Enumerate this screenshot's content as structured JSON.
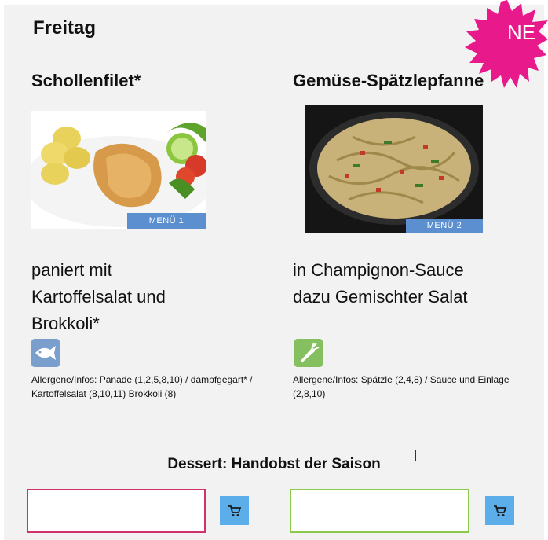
{
  "day": {
    "title": "Freitag"
  },
  "badge": {
    "label": "NE",
    "color": "#e8198b"
  },
  "dishes": [
    {
      "title": "Schollenfilet*",
      "menu_label": "MENÜ 1",
      "desc_lines": [
        "paniert mit",
        "Kartoffelsalat und",
        "Brokkoli*"
      ],
      "icon": "fish-icon",
      "allergen": "Allergene/Infos: Panade (1,2,5,8,10) / dampfgegart* / Kartoffelsalat (8,10,11) Brokkoli (8)",
      "input_border": "#d0336c"
    },
    {
      "title": "Gemüse-Spätzlepfanne",
      "menu_label": "MENÜ 2",
      "desc_lines": [
        "in Champignon-Sauce",
        "dazu Gemischter Salat"
      ],
      "icon": "carrot-icon",
      "allergen": "Allergene/Infos: Spätzle (2,4,8)  / Sauce und Einlage (2,8,10)",
      "input_border": "#8cc84b"
    }
  ],
  "dessert": {
    "text": "Dessert: Handobst der Saison"
  },
  "cart": {
    "icon": "cart-icon",
    "color": "#5baeea"
  }
}
